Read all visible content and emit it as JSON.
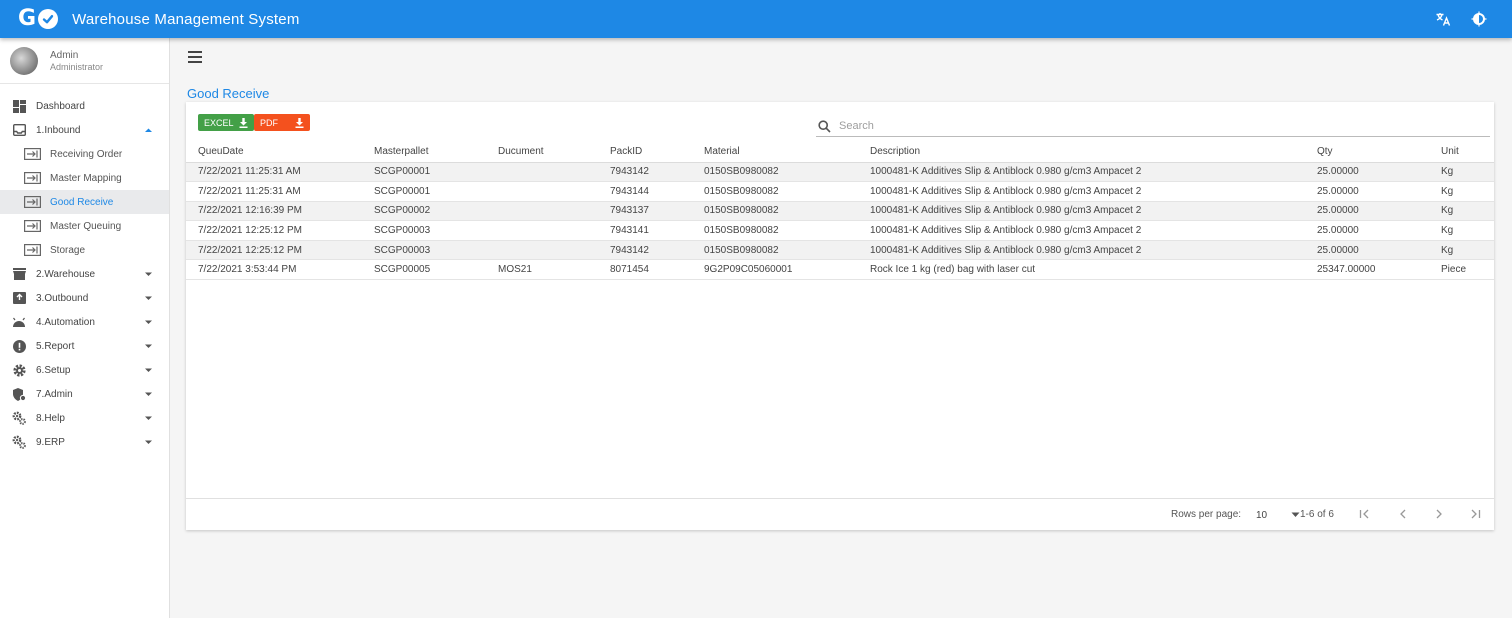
{
  "app": {
    "title": "Warehouse Management System",
    "logo_letter": "G"
  },
  "topbar": {
    "icons": [
      "translate-icon",
      "theme-toggle-icon"
    ]
  },
  "user": {
    "name": "Admin",
    "role": "Administrator"
  },
  "sidebar": {
    "items": [
      {
        "label": "Dashboard",
        "icon": "dashboard-icon",
        "expandable": false
      },
      {
        "label": "1.Inbound",
        "icon": "inbox-icon",
        "expandable": true,
        "expanded": true,
        "children": [
          {
            "label": "Receiving Order"
          },
          {
            "label": "Master Mapping"
          },
          {
            "label": "Good Receive",
            "active": true
          },
          {
            "label": "Master Queuing"
          },
          {
            "label": "Storage"
          }
        ]
      },
      {
        "label": "2.Warehouse",
        "icon": "store-icon",
        "expandable": true
      },
      {
        "label": "3.Outbound",
        "icon": "outbox-icon",
        "expandable": true
      },
      {
        "label": "4.Automation",
        "icon": "robot-icon",
        "expandable": true
      },
      {
        "label": "5.Report",
        "icon": "alert-icon",
        "expandable": true
      },
      {
        "label": "6.Setup",
        "icon": "gear-icon",
        "expandable": true
      },
      {
        "label": "7.Admin",
        "icon": "admin-icon",
        "expandable": true
      },
      {
        "label": "8.Help",
        "icon": "gears-icon",
        "expandable": true
      },
      {
        "label": "9.ERP",
        "icon": "gears-icon",
        "expandable": true
      }
    ]
  },
  "page": {
    "title": "Good Receive"
  },
  "toolbar": {
    "excel_label": "EXCEL",
    "pdf_label": "PDF"
  },
  "search": {
    "placeholder": "Search",
    "value": ""
  },
  "table": {
    "columns": [
      "QueuDate",
      "Masterpallet",
      "Ducument",
      "PackID",
      "Material",
      "Description",
      "Qty",
      "Unit"
    ],
    "rows": [
      [
        "7/22/2021 11:25:31 AM",
        "SCGP00001",
        "",
        "7943142",
        "0150SB0980082",
        "1000481-K Additives Slip & Antiblock 0.980 g/cm3 Ampacet 2",
        "25.00000",
        "Kg"
      ],
      [
        "7/22/2021 11:25:31 AM",
        "SCGP00001",
        "",
        "7943144",
        "0150SB0980082",
        "1000481-K Additives Slip & Antiblock 0.980 g/cm3 Ampacet 2",
        "25.00000",
        "Kg"
      ],
      [
        "7/22/2021 12:16:39 PM",
        "SCGP00002",
        "",
        "7943137",
        "0150SB0980082",
        "1000481-K Additives Slip & Antiblock 0.980 g/cm3 Ampacet 2",
        "25.00000",
        "Kg"
      ],
      [
        "7/22/2021 12:25:12 PM",
        "SCGP00003",
        "",
        "7943141",
        "0150SB0980082",
        "1000481-K Additives Slip & Antiblock 0.980 g/cm3 Ampacet 2",
        "25.00000",
        "Kg"
      ],
      [
        "7/22/2021 12:25:12 PM",
        "SCGP00003",
        "",
        "7943142",
        "0150SB0980082",
        "1000481-K Additives Slip & Antiblock 0.980 g/cm3 Ampacet 2",
        "25.00000",
        "Kg"
      ],
      [
        "7/22/2021 3:53:44 PM",
        "SCGP00005",
        "MOS21",
        "8071454",
        "9G2P09C05060001",
        "Rock Ice 1 kg (red) bag with laser cut",
        "25347.00000",
        "Piece"
      ]
    ]
  },
  "pagination": {
    "rows_label": "Rows per page:",
    "rows_value": "10",
    "range": "1-6 of 6"
  },
  "colors": {
    "primary": "#1e88e5",
    "excel": "#43a047",
    "pdf": "#f4511e"
  }
}
